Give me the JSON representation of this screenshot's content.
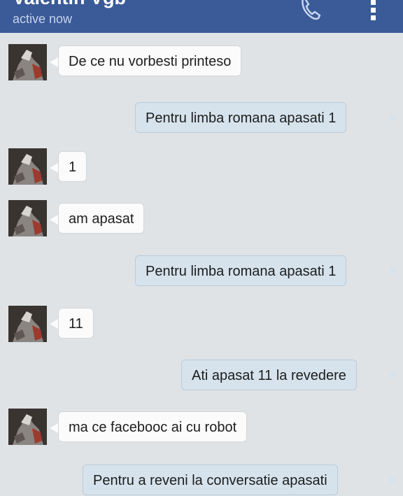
{
  "header": {
    "contact_name": "Valentin Vgb",
    "status": "active now",
    "call_icon": "phone-icon",
    "menu_icon": "overflow-menu-icon",
    "background_color": "#3a5a98"
  },
  "messages": [
    {
      "direction": "incoming",
      "text": "De ce nu vorbesti printeso"
    },
    {
      "direction": "outgoing",
      "text": "Pentru limba romana apasati 1"
    },
    {
      "direction": "incoming",
      "text": "1"
    },
    {
      "direction": "incoming",
      "text": "am apasat"
    },
    {
      "direction": "outgoing",
      "text": "Pentru limba romana apasati 1"
    },
    {
      "direction": "incoming",
      "text": "11"
    },
    {
      "direction": "outgoing",
      "text": "Ati apasat 11 la revedere"
    },
    {
      "direction": "incoming",
      "text": "ma ce facebooc ai cu robot"
    },
    {
      "direction": "outgoing",
      "text": "Pentru a reveni la conversatie apasati"
    }
  ],
  "colors": {
    "incoming_bubble": "#fbfbfb",
    "outgoing_bubble": "#d6e3ec",
    "chat_background": "#dfe3e6"
  }
}
